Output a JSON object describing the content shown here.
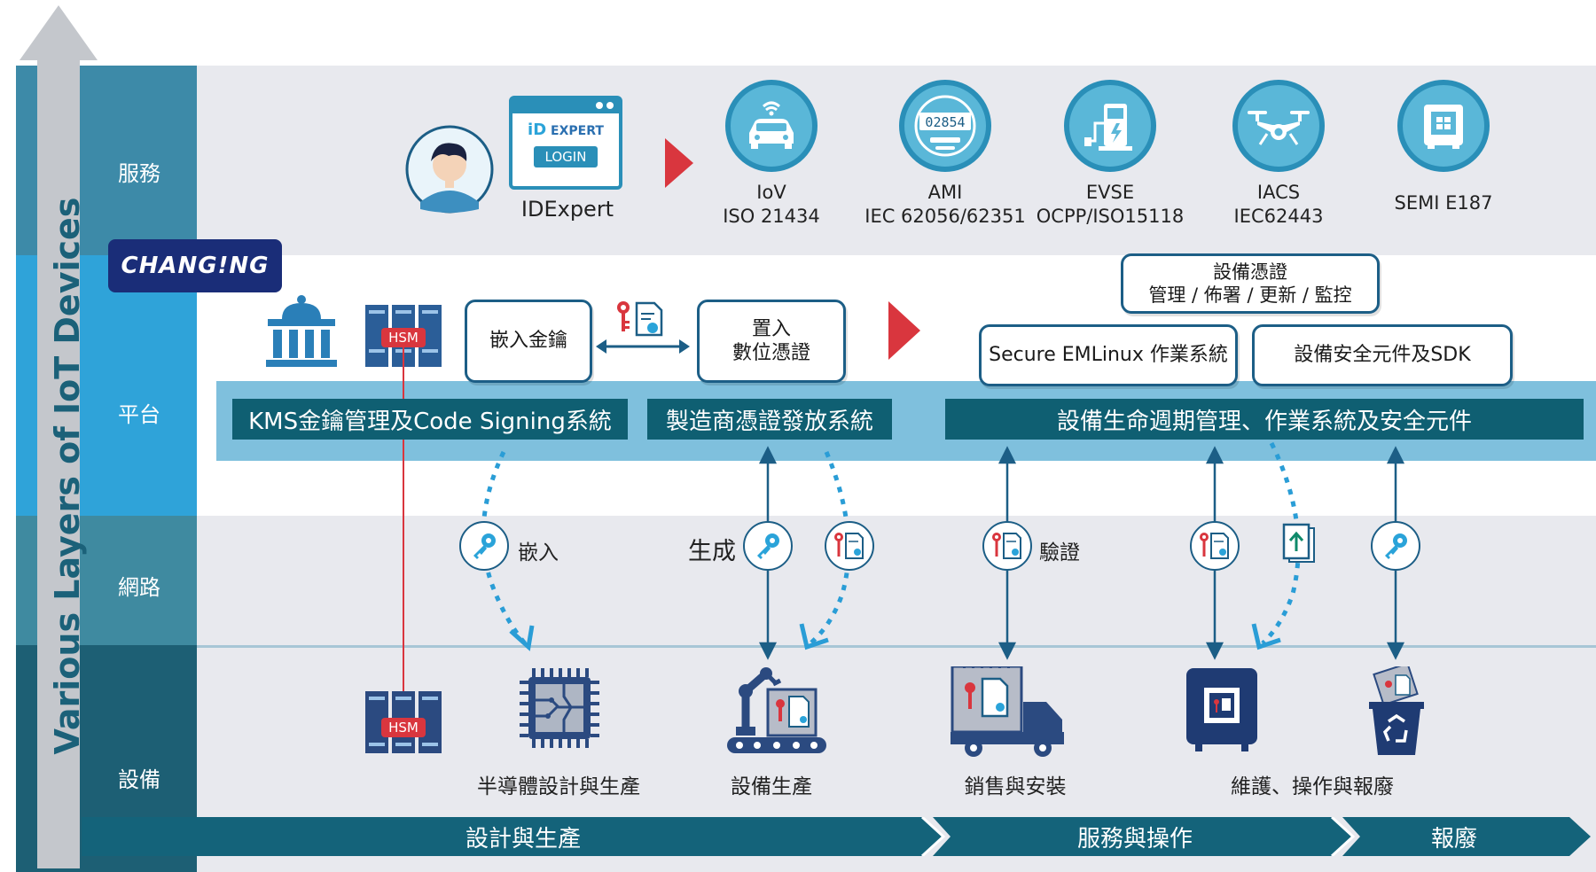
{
  "axis_label": "Various Layers of IoT Devices",
  "layers": [
    "服務",
    "平台",
    "網路",
    "設備"
  ],
  "brand": "CHANG!NG",
  "service": {
    "idexpert_logo": "EXPERT",
    "login_button": "LOGIN",
    "idexpert_caption": "IDExpert",
    "standards": [
      {
        "name": "IoV",
        "std": "ISO 21434",
        "icon": "car-icon"
      },
      {
        "name": "AMI",
        "std": "IEC 62056/62351",
        "icon": "meter-icon",
        "meter_digits": "02854"
      },
      {
        "name": "EVSE",
        "std": "OCPP/ISO15118",
        "icon": "ev-charger-icon"
      },
      {
        "name": "IACS",
        "std": "IEC62443",
        "icon": "drone-icon"
      },
      {
        "name": "SEMI E187",
        "std": "",
        "icon": "chip-box-icon"
      }
    ]
  },
  "platform": {
    "hsm_label": "HSM",
    "embed_key": "嵌入金鑰",
    "cert_line1": "置入",
    "cert_line2": "數位憑證",
    "lifecycle_line1": "設備憑證",
    "lifecycle_line2": "管理 / 佈署 / 更新 / 監控",
    "emlinux": "Secure EMLinux 作業系統",
    "sdk": "設備安全元件及SDK",
    "kms_bar": "KMS金鑰管理及Code Signing系統",
    "mfr_bar": "製造商憑證發放系統",
    "lifecycle_bar": "設備生命週期管理、作業系統及安全元件"
  },
  "network": {
    "embed": "嵌入",
    "generate": "生成",
    "verify": "驗證"
  },
  "device": {
    "hsm_label": "HSM",
    "stages": [
      "半導體設計與生產",
      "設備生產",
      "銷售與安裝",
      "維護、操作與報廢"
    ]
  },
  "phases": [
    "設計與生產",
    "服務與操作",
    "報廢"
  ],
  "colors": {
    "service_side": "#3d8aa8",
    "platform_side": "#2fa3d9",
    "network_side": "#3f8aa0",
    "device_side": "#1d5f74",
    "dark_bar": "#0f5f72",
    "red": "#d9363e"
  }
}
